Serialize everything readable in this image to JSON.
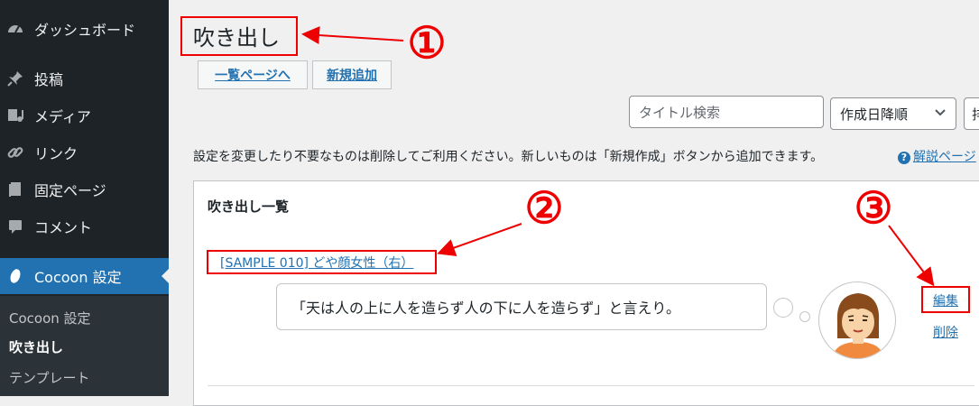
{
  "sidebar": {
    "items": [
      {
        "label": "ダッシュボード",
        "icon": "dashboard-icon"
      },
      {
        "label": "投稿",
        "icon": "pin-icon"
      },
      {
        "label": "メディア",
        "icon": "media-icon"
      },
      {
        "label": "リンク",
        "icon": "link-icon"
      },
      {
        "label": "固定ページ",
        "icon": "page-icon"
      },
      {
        "label": "コメント",
        "icon": "comment-icon"
      },
      {
        "label": "Cocoon 設定",
        "icon": "cocoon-icon"
      }
    ],
    "submenu": [
      "Cocoon 設定",
      "吹き出し",
      "テンプレート"
    ]
  },
  "header": {
    "title": "吹き出し",
    "list_button": "一覧ページへ",
    "new_button": "新規追加"
  },
  "toolbar": {
    "search_placeholder": "タイトル検索",
    "sort_value": "作成日降順",
    "filter_label": "排"
  },
  "description": "設定を変更したり不要なものは削除してご利用ください。新しいものは「新規作成」ボタンから追加できます。",
  "help_link": "解説ページ",
  "panel": {
    "title": "吹き出し一覧",
    "item": {
      "name": "[SAMPLE 010] どや顔女性（右）",
      "speech": "「天は人の上に人を造らず人の下に人を造らず」と言えり。",
      "edit": "編集",
      "delete": "削除"
    }
  },
  "annotations": {
    "one": "①",
    "two": "②",
    "three": "③",
    "color": "#e00000"
  }
}
